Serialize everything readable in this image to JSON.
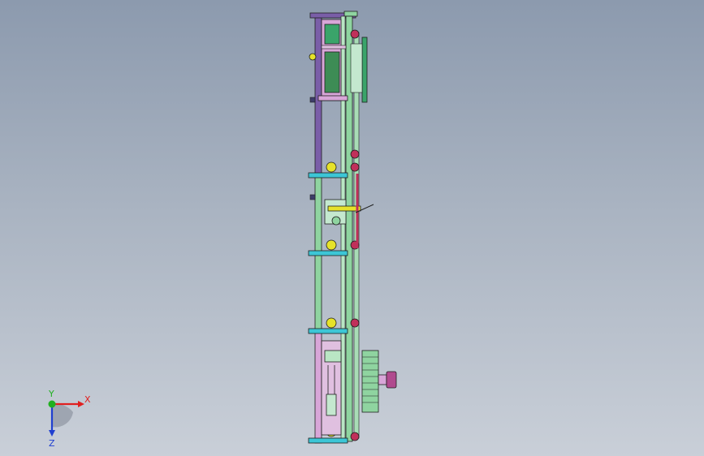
{
  "viewport": {
    "background_top": "#8c9aae",
    "background_bottom": "#c9cfd8"
  },
  "model": {
    "colors": {
      "frame_purple": "#7a5ea8",
      "frame_pink": "#d8a6d8",
      "rail_green": "#8fd4a0",
      "rail_dark": "#3d8c55",
      "crossbar_cyan": "#3cc6d6",
      "roller_yellow": "#e6e22a",
      "accent_red": "#c0305a",
      "motor_green": "#3aa46a",
      "hub_magenta": "#b04a8e",
      "edge": "#1e1e1e"
    }
  },
  "triad": {
    "x_label": "X",
    "y_label": "Y",
    "z_label": "Z",
    "x_color": "#e02020",
    "y_color": "#20b020",
    "z_color": "#2040d0"
  }
}
